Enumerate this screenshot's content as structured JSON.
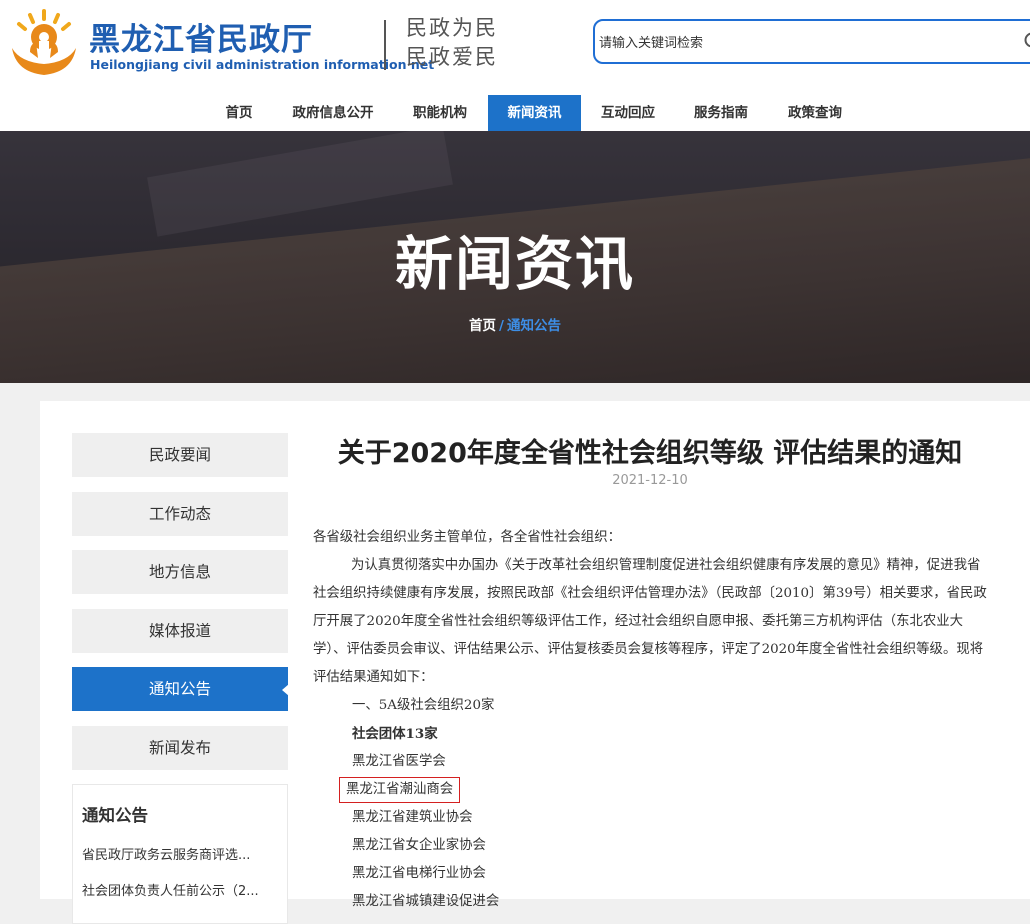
{
  "header": {
    "title_cn": "黑龙江省民政厅",
    "title_en": "Heilongjiang civil administration information net",
    "slogan_line1": "民政为民",
    "slogan_line2": "民政爱民",
    "search_placeholder": "请输入关键词检索",
    "brand_color": "#1f5eb1"
  },
  "nav": {
    "items": [
      "首页",
      "政府信息公开",
      "职能机构",
      "新闻资讯",
      "互动回应",
      "服务指南",
      "政策查询"
    ],
    "active_index": 3,
    "active_color": "#1d72c9"
  },
  "banner": {
    "title": "新闻资讯",
    "breadcrumb_home": "首页",
    "breadcrumb_sep": "/",
    "breadcrumb_current": "通知公告"
  },
  "sidebar": {
    "items": [
      "民政要闻",
      "工作动态",
      "地方信息",
      "媒体报道",
      "通知公告",
      "新闻发布"
    ],
    "active_index": 4,
    "notice_box": {
      "heading": "通知公告",
      "links": [
        "省民政厅政务云服务商评选...",
        "社会团体负责人任前公示（2..."
      ]
    }
  },
  "article": {
    "title": "关于2020年度全省性社会组织等级 评估结果的通知",
    "date": "2021-12-10",
    "salutation": "各省级社会组织业务主管单位，各全省性社会组织：",
    "paragraph": "为认真贯彻落实中办国办《关于改革社会组织管理制度促进社会组织健康有序发展的意见》精神，促进我省社会组织持续健康有序发展，按照民政部《社会组织评估管理办法》（民政部〔2010〕第39号）相关要求，省民政厅开展了2020年度全省性社会组织等级评估工作，经过社会组织自愿申报、委托第三方机构评估（东北农业大学）、评估委员会审议、评估结果公示、评估复核委员会复核等程序，评定了2020年度全省性社会组织等级。现将评估结果通知如下：",
    "section1": "一、5A级社会组织20家",
    "subsection": "社会团体13家",
    "orgs": [
      "黑龙江省医学会",
      "黑龙江省潮汕商会",
      "黑龙江省建筑业协会",
      "黑龙江省女企业家协会",
      "黑龙江省电梯行业协会",
      "黑龙江省城镇建设促进会"
    ],
    "highlight_index": 1,
    "highlight_color": "#d42020"
  }
}
